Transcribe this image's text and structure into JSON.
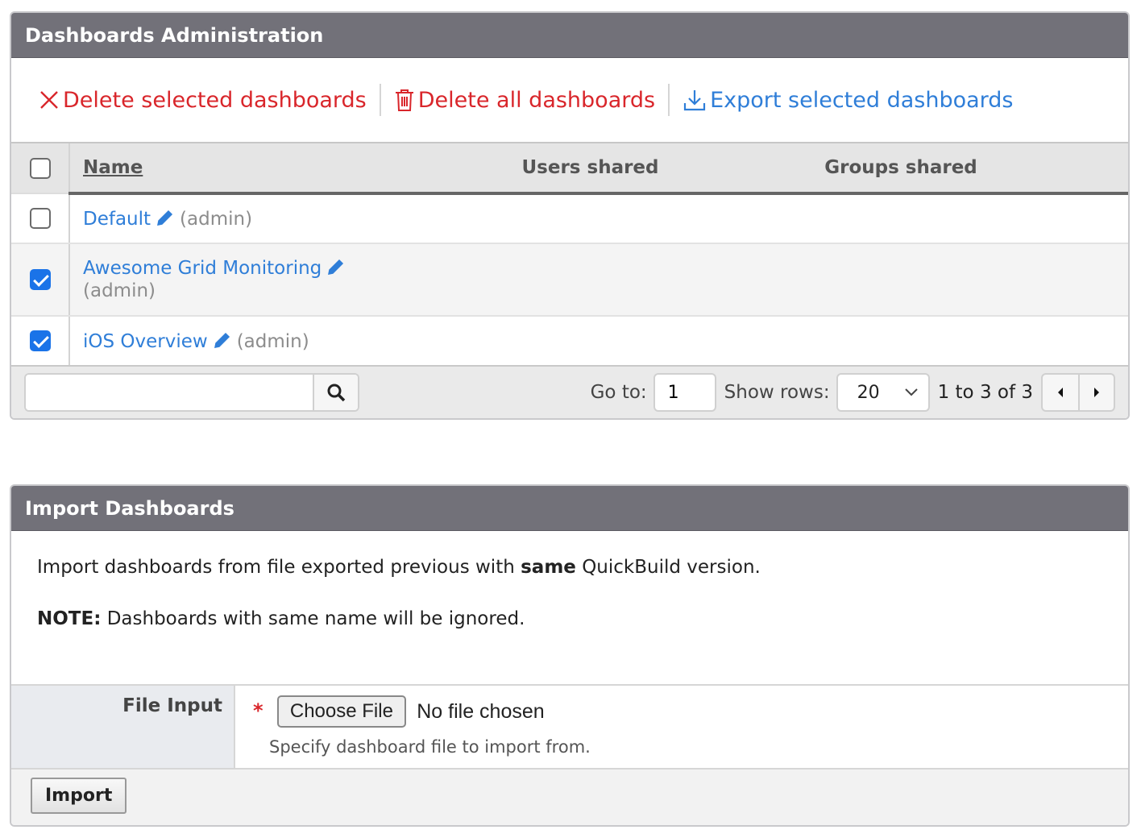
{
  "admin_panel": {
    "title": "Dashboards Administration",
    "actions": {
      "delete_selected": "Delete selected dashboards",
      "delete_all": "Delete all dashboards",
      "export_selected": "Export selected dashboards"
    },
    "table": {
      "headers": {
        "name": "Name",
        "users_shared": "Users shared",
        "groups_shared": "Groups shared"
      },
      "rows": [
        {
          "name": "Default",
          "owner": "(admin)",
          "checked": false
        },
        {
          "name": "Awesome Grid Monitoring",
          "owner": "(admin)",
          "checked": true
        },
        {
          "name": "iOS Overview",
          "owner": "(admin)",
          "checked": true
        }
      ]
    },
    "footer": {
      "search_value": "",
      "goto_label": "Go to:",
      "goto_value": "1",
      "show_rows_label": "Show rows:",
      "show_rows_value": "20",
      "range_text": "1 to 3 of 3"
    }
  },
  "import_panel": {
    "title": "Import Dashboards",
    "description_pre": "Import dashboards from file exported previous with ",
    "description_bold": "same",
    "description_post": " QuickBuild version.",
    "note_label": "NOTE:",
    "note_text": " Dashboards with same name will be ignored.",
    "file_input_label": "File Input",
    "required_mark": "*",
    "choose_file_label": "Choose File",
    "file_status": "No file chosen",
    "hint": "Specify dashboard file to import from.",
    "import_button": "Import"
  },
  "colors": {
    "header_bg": "#727179",
    "danger": "#d9262b",
    "link": "#2f7ed8",
    "checkbox_checked": "#1a73e8"
  }
}
